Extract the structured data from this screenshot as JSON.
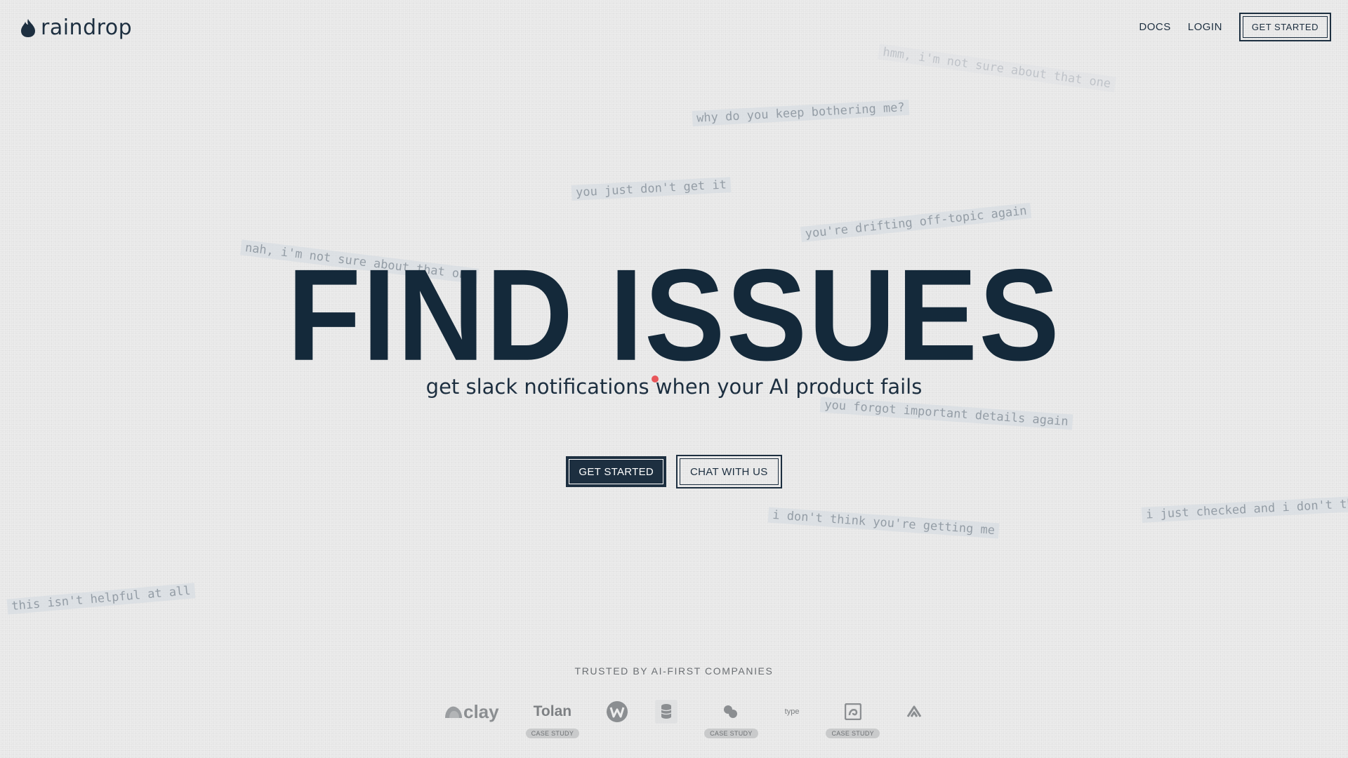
{
  "nav": {
    "brand": "raindrop",
    "links": [
      "DOCS",
      "LOGIN"
    ],
    "cta": "GET STARTED"
  },
  "floaters": [
    "why do you keep bothering me?",
    "you just don't get it",
    "you're drifting off-topic again",
    "nah, i'm not sure about that one",
    "you forgot important details again",
    "i don't think you're getting me",
    "i just checked and i don't think",
    "this isn't helpful at all",
    "hmm, i'm not sure about that one"
  ],
  "hero": {
    "title": "FIND ISSUES",
    "subtitle": "get slack notifications when your AI product fails"
  },
  "cta": {
    "primary": "GET STARTED",
    "secondary": "CHAT WITH US"
  },
  "trusted": {
    "label": "TRUSTED BY AI-FIRST COMPANIES",
    "logos": [
      {
        "icon": "clay-logo",
        "text": "clay"
      },
      {
        "icon": "tolan-logo",
        "text": "Tolan",
        "badge": "CASE STUDY"
      },
      {
        "icon": "w-circle-logo"
      },
      {
        "icon": "stack-logo"
      },
      {
        "icon": "blob-logo",
        "badge": "CASE STUDY"
      },
      {
        "icon": "type-logo",
        "text": "type"
      },
      {
        "icon": "square-swirl-logo",
        "badge": "CASE STUDY"
      },
      {
        "icon": "chevron-a-logo"
      }
    ]
  },
  "colors": {
    "background": "#ececec",
    "ink": "#1d2f40",
    "title": "#14293a",
    "accent_dot": "#e8565a",
    "muted": "#8b8e91"
  }
}
